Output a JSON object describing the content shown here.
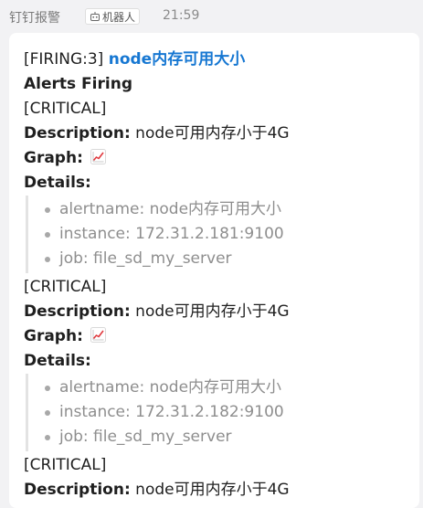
{
  "header": {
    "sender": "钉钉报警",
    "badge": "机器人",
    "time": "21:59"
  },
  "message": {
    "firing_prefix": "[FIRING:3]",
    "title": "node内存可用大小",
    "subtitle": "Alerts Firing",
    "alerts": [
      {
        "severity": "[CRITICAL]",
        "description_label": "Description:",
        "description": "node可用内存小于4G",
        "graph_label": "Graph:",
        "graph_icon": "chart-increasing-icon",
        "details_label": "Details:",
        "details": [
          "alertname: node内存可用大小",
          "instance: 172.31.2.181:9100",
          "job: file_sd_my_server"
        ]
      },
      {
        "severity": "[CRITICAL]",
        "description_label": "Description:",
        "description": "node可用内存小于4G",
        "graph_label": "Graph:",
        "graph_icon": "chart-increasing-icon",
        "details_label": "Details:",
        "details": [
          "alertname: node内存可用大小",
          "instance: 172.31.2.182:9100",
          "job: file_sd_my_server"
        ]
      },
      {
        "severity": "[CRITICAL]",
        "description_label": "Description:",
        "description": "node可用内存小于4G"
      }
    ]
  },
  "colors": {
    "link": "#1677d2",
    "detail_text": "#8e8e8e",
    "background": "#f2f2f4"
  }
}
